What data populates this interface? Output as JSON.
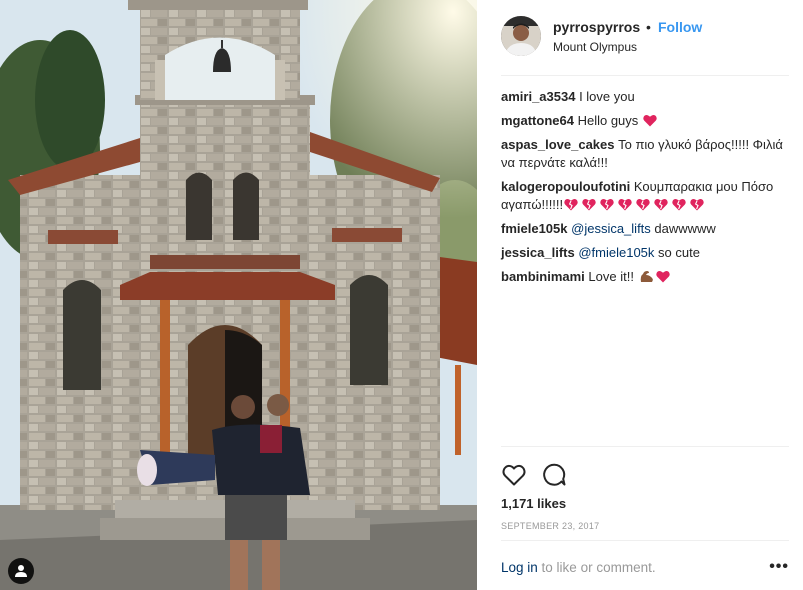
{
  "post": {
    "username": "pyrrospyrros",
    "dot": "•",
    "follow_label": "Follow",
    "location": "Mount Olympus",
    "likes": "1,171 likes",
    "date": "SEPTEMBER 23, 2017",
    "login_link": "Log in",
    "login_suffix": " to like or comment.",
    "more_label": "•••"
  },
  "comments": [
    {
      "author": "amiri_a3534",
      "text": " I love you"
    },
    {
      "author": "mgattone64",
      "text": " Hello guys "
    },
    {
      "author": "aspas_love_cakes",
      "text": " Το πιο γλυκό βάρος!!!!! Φιλιά να περνάτε καλά!!!"
    },
    {
      "author": "kalogeropouloufotini",
      "text": " Κουμπαρακια μου Πόσο αγαπώ!!!!!!"
    },
    {
      "author": "fmiele105k",
      "mention": "@jessica_lifts",
      "text": " dawwwww"
    },
    {
      "author": "jessica_lifts",
      "mention": "@fmiele105k",
      "text": " so cute"
    },
    {
      "author": "bambinimami",
      "text": " Love it!! "
    }
  ],
  "icons": {
    "heart": "heart-outline-icon",
    "comment": "comment-bubble-icon",
    "user_tag": "user-tag-icon",
    "red_heart": "red-heart-emoji",
    "broken_heart": "broken-heart-emoji",
    "flexed_biceps": "flexed-biceps-emoji"
  },
  "colors": {
    "link_blue": "#3897f0",
    "mention_blue": "#003569",
    "text": "#262626",
    "muted": "#999999",
    "divider": "#efefef",
    "emoji_red": "#e0245e"
  }
}
